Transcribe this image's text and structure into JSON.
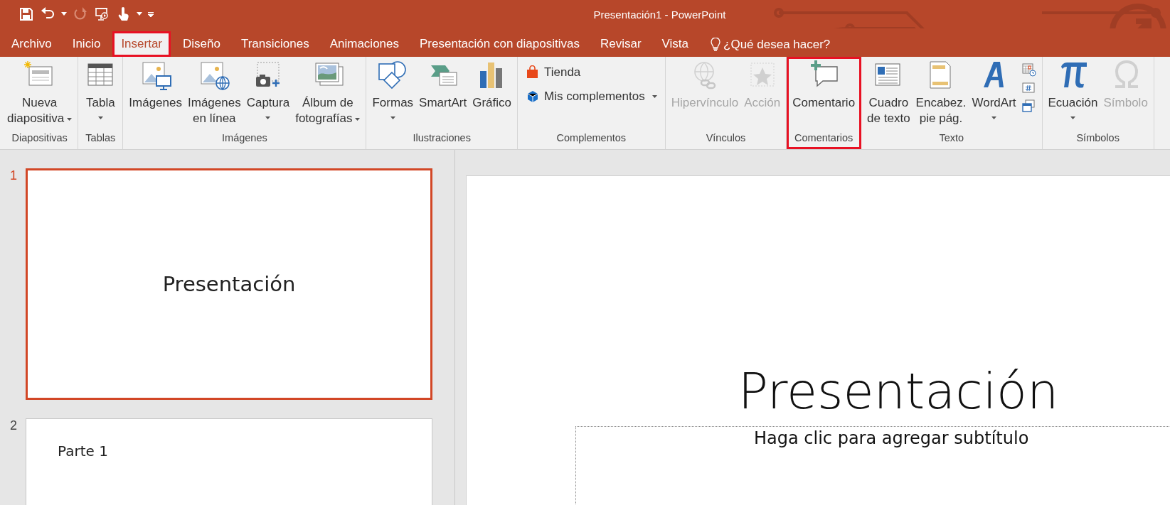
{
  "window": {
    "title": "Presentación1 - PowerPoint"
  },
  "quick_access": [
    {
      "kind": "save",
      "disabled": false
    },
    {
      "kind": "undo",
      "disabled": false
    },
    {
      "kind": "caret",
      "disabled": false
    },
    {
      "kind": "redo",
      "disabled": true
    },
    {
      "kind": "present",
      "disabled": false
    },
    {
      "kind": "touch",
      "disabled": false
    },
    {
      "kind": "caret",
      "disabled": false
    },
    {
      "kind": "customize",
      "disabled": false
    }
  ],
  "tabs": [
    {
      "label": "Archivo",
      "selected": false,
      "highlighted": false
    },
    {
      "label": "Inicio",
      "selected": false,
      "highlighted": false
    },
    {
      "label": "Insertar",
      "selected": true,
      "highlighted": true
    },
    {
      "label": "Diseño",
      "selected": false,
      "highlighted": false
    },
    {
      "label": "Transiciones",
      "selected": false,
      "highlighted": false
    },
    {
      "label": "Animaciones",
      "selected": false,
      "highlighted": false
    },
    {
      "label": "Presentación con diapositivas",
      "selected": false,
      "highlighted": false
    },
    {
      "label": "Revisar",
      "selected": false,
      "highlighted": false
    },
    {
      "label": "Vista",
      "selected": false,
      "highlighted": false
    }
  ],
  "search": {
    "placeholder": "¿Qué desea hacer?"
  },
  "ribbon": {
    "groups": [
      {
        "label": "Diapositivas",
        "highlighted": false,
        "buttons": [
          {
            "kind": "large",
            "label": [
              "Nueva",
              "diapositiva"
            ],
            "dropdown": true,
            "disabled": false
          }
        ]
      },
      {
        "label": "Tablas",
        "highlighted": false,
        "buttons": [
          {
            "kind": "large",
            "label": [
              "Tabla"
            ],
            "dropdown": true,
            "disabled": false
          }
        ]
      },
      {
        "label": "Imágenes",
        "highlighted": false,
        "buttons": [
          {
            "kind": "large",
            "label": [
              "Imágenes"
            ],
            "dropdown": false,
            "disabled": false
          },
          {
            "kind": "large",
            "label": [
              "Imágenes",
              "en línea"
            ],
            "dropdown": false,
            "disabled": false
          },
          {
            "kind": "large",
            "label": [
              "Captura"
            ],
            "dropdown": true,
            "disabled": false
          },
          {
            "kind": "large",
            "label": [
              "Álbum de",
              "fotografías"
            ],
            "dropdown": true,
            "disabled": false
          }
        ]
      },
      {
        "label": "Ilustraciones",
        "highlighted": false,
        "buttons": [
          {
            "kind": "large",
            "label": [
              "Formas"
            ],
            "dropdown": true,
            "disabled": false
          },
          {
            "kind": "large",
            "label": [
              "SmartArt"
            ],
            "dropdown": false,
            "disabled": false
          },
          {
            "kind": "large",
            "label": [
              "Gráfico"
            ],
            "dropdown": false,
            "disabled": false
          }
        ]
      },
      {
        "label": "Complementos",
        "highlighted": false,
        "buttons": [
          {
            "kind": "small",
            "label": [
              "Tienda"
            ],
            "dropdown": false,
            "disabled": false
          },
          {
            "kind": "small",
            "label": [
              "Mis complementos"
            ],
            "dropdown": true,
            "disabled": false
          }
        ]
      },
      {
        "label": "Vínculos",
        "highlighted": false,
        "buttons": [
          {
            "kind": "large",
            "label": [
              "Hipervínculo"
            ],
            "dropdown": false,
            "disabled": true
          },
          {
            "kind": "large",
            "label": [
              "Acción"
            ],
            "dropdown": false,
            "disabled": true
          }
        ]
      },
      {
        "label": "Comentarios",
        "highlighted": true,
        "buttons": [
          {
            "kind": "large",
            "label": [
              "Comentario"
            ],
            "dropdown": false,
            "disabled": false
          }
        ]
      },
      {
        "label": "Texto",
        "highlighted": false,
        "buttons": [
          {
            "kind": "large",
            "label": [
              "Cuadro",
              "de texto"
            ],
            "dropdown": false,
            "disabled": false
          },
          {
            "kind": "large",
            "label": [
              "Encabez.",
              "pie pág."
            ],
            "dropdown": false,
            "disabled": false
          },
          {
            "kind": "large",
            "label": [
              "WordArt"
            ],
            "dropdown": true,
            "disabled": false
          },
          {
            "kind": "icon"
          },
          {
            "kind": "icon"
          },
          {
            "kind": "icon"
          }
        ]
      },
      {
        "label": "Símbolos",
        "highlighted": false,
        "buttons": [
          {
            "kind": "large",
            "label": [
              "Ecuación"
            ],
            "dropdown": true,
            "disabled": false
          },
          {
            "kind": "large",
            "label": [
              "Símbolo"
            ],
            "dropdown": false,
            "disabled": true
          }
        ]
      }
    ]
  },
  "slides_panel": {
    "slides": [
      {
        "number": "1",
        "selected": true,
        "kind": "title",
        "text": "Presentación"
      },
      {
        "number": "2",
        "selected": false,
        "kind": "section",
        "text": "Parte 1"
      }
    ]
  },
  "editor": {
    "title": "Presentación",
    "subtitle_placeholder": "Haga clic para agregar subtítulo"
  }
}
